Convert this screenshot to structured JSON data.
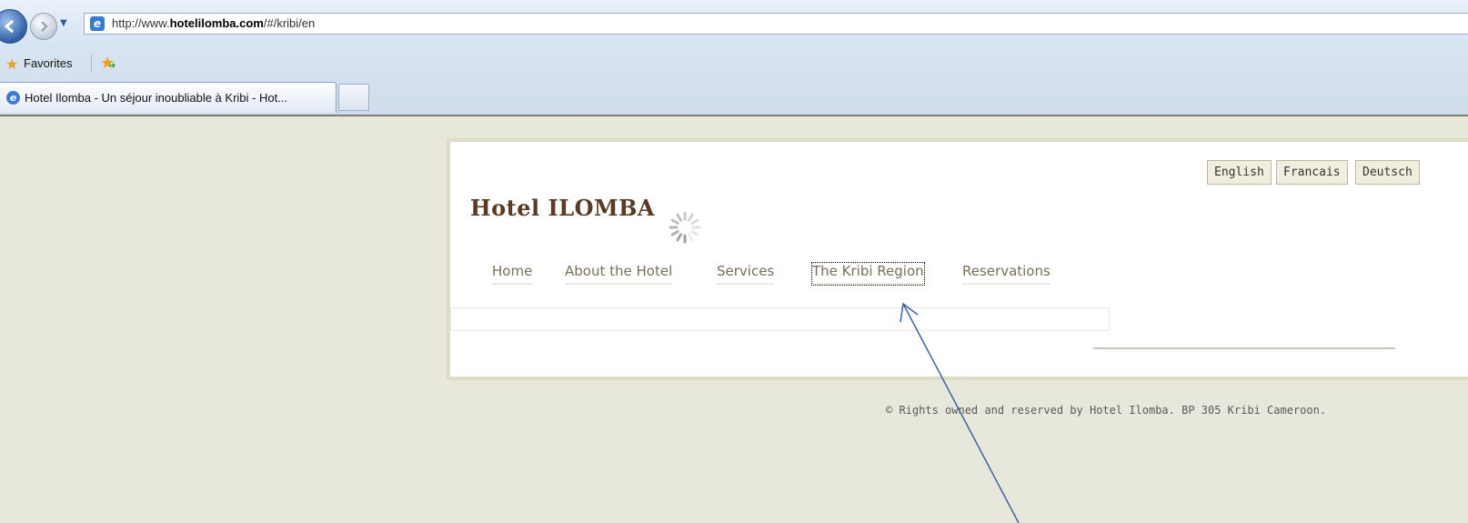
{
  "browser": {
    "url_prefix": "http://www.",
    "url_domain": "hotelilomba.com",
    "url_suffix": "/#/kribi/en",
    "favorites_label": "Favorites",
    "tab_title": "Hotel Ilomba - Un séjour inoubliable à Kribi - Hot..."
  },
  "site": {
    "logo": "Hotel ILOMBA",
    "languages": [
      "English",
      "Francais",
      "Deutsch"
    ],
    "menu": [
      "Home",
      "About the Hotel",
      "Services",
      "The Kribi Region",
      "Reservations"
    ],
    "footer": "© Rights owned and reserved by Hotel Ilomba. BP 305 Kribi Cameroon."
  },
  "annotation": {
    "arrow_color": "#3b64a3"
  }
}
